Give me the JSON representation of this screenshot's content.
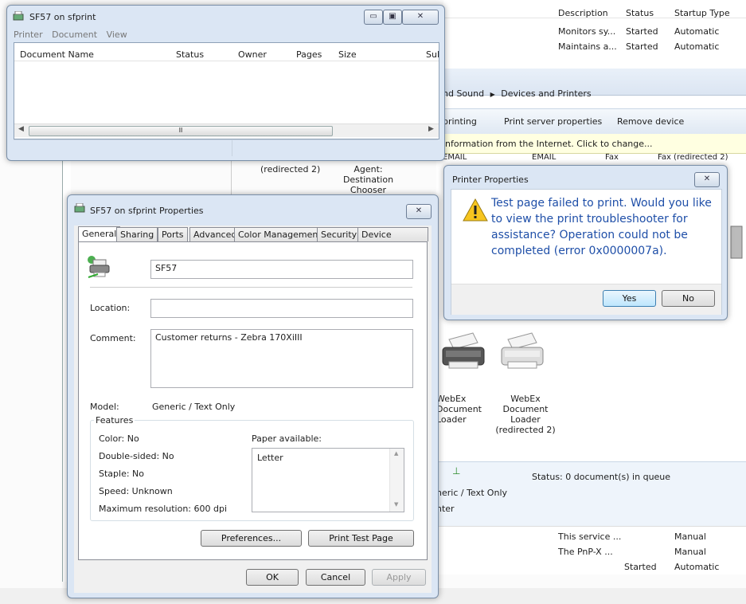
{
  "services": {
    "headers": {
      "description": "Description",
      "status": "Status",
      "startup": "Startup Type"
    },
    "rows_top": [
      {
        "description": "Monitors sy...",
        "status": "Started",
        "startup": "Automatic"
      },
      {
        "description": "Maintains a...",
        "status": "Started",
        "startup": "Automatic"
      }
    ],
    "rows_bottom": [
      {
        "description": "This service ...",
        "status": "",
        "startup": "Manual"
      },
      {
        "description": "The PnP-X ...",
        "status": "",
        "startup": "Manual"
      },
      {
        "description": "",
        "status": "Started",
        "startup": "Automatic"
      }
    ]
  },
  "devices": {
    "breadcrumb_part1": "nd Sound",
    "breadcrumb_part2": "Devices and Printers",
    "toolbar": {
      "item1": "printing",
      "item2": "Print server properties",
      "item3": "Remove device"
    },
    "infobar": "information from the Internet. Click to change...",
    "label_email1": "EMAIL",
    "label_email2": "EMAIL",
    "label_fax1": "Fax",
    "label_fax2": "Fax (redirected 2)",
    "label_redirected": "(redirected 2)",
    "label_agent": "Agent: Destination Chooser (MRU...",
    "label_webex1": "WebEx Document Loader",
    "label_webex2": "WebEx Document Loader (redirected 2)",
    "details_status": "Status: 0 document(s) in queue",
    "details_model": "neric / Text Only",
    "details_cat": "nter"
  },
  "queue_window": {
    "title": "SF57 on sfprint",
    "menu": [
      "Printer",
      "Document",
      "View"
    ],
    "columns": [
      "Document Name",
      "Status",
      "Owner",
      "Pages",
      "Size",
      "Sul"
    ]
  },
  "props_window": {
    "title": "SF57 on sfprint Properties",
    "tabs": [
      "General",
      "Sharing",
      "Ports",
      "Advanced",
      "Color Management",
      "Security",
      "Device Settings"
    ],
    "printer_name": "SF57",
    "location_label": "Location:",
    "location_value": "",
    "comment_label": "Comment:",
    "comment_value": "Customer returns - Zebra 170XiIII",
    "model_label": "Model:",
    "model_value": "Generic / Text Only",
    "features_label": "Features",
    "color": "Color: No",
    "double_sided": "Double-sided: No",
    "staple": "Staple: No",
    "speed": "Speed: Unknown",
    "max_res": "Maximum resolution: 600 dpi",
    "paper_label": "Paper available:",
    "paper_items": [
      "Letter"
    ],
    "preferences_btn": "Preferences...",
    "print_test_btn": "Print Test Page",
    "ok_btn": "OK",
    "cancel_btn": "Cancel",
    "apply_btn": "Apply"
  },
  "dialog": {
    "title": "Printer Properties",
    "message": "Test page failed to print. Would you like to view the print troubleshooter for assistance? Operation could not be completed (error 0x0000007a).",
    "yes_btn": "Yes",
    "no_btn": "No",
    "text_color": "#1f4fa8"
  }
}
